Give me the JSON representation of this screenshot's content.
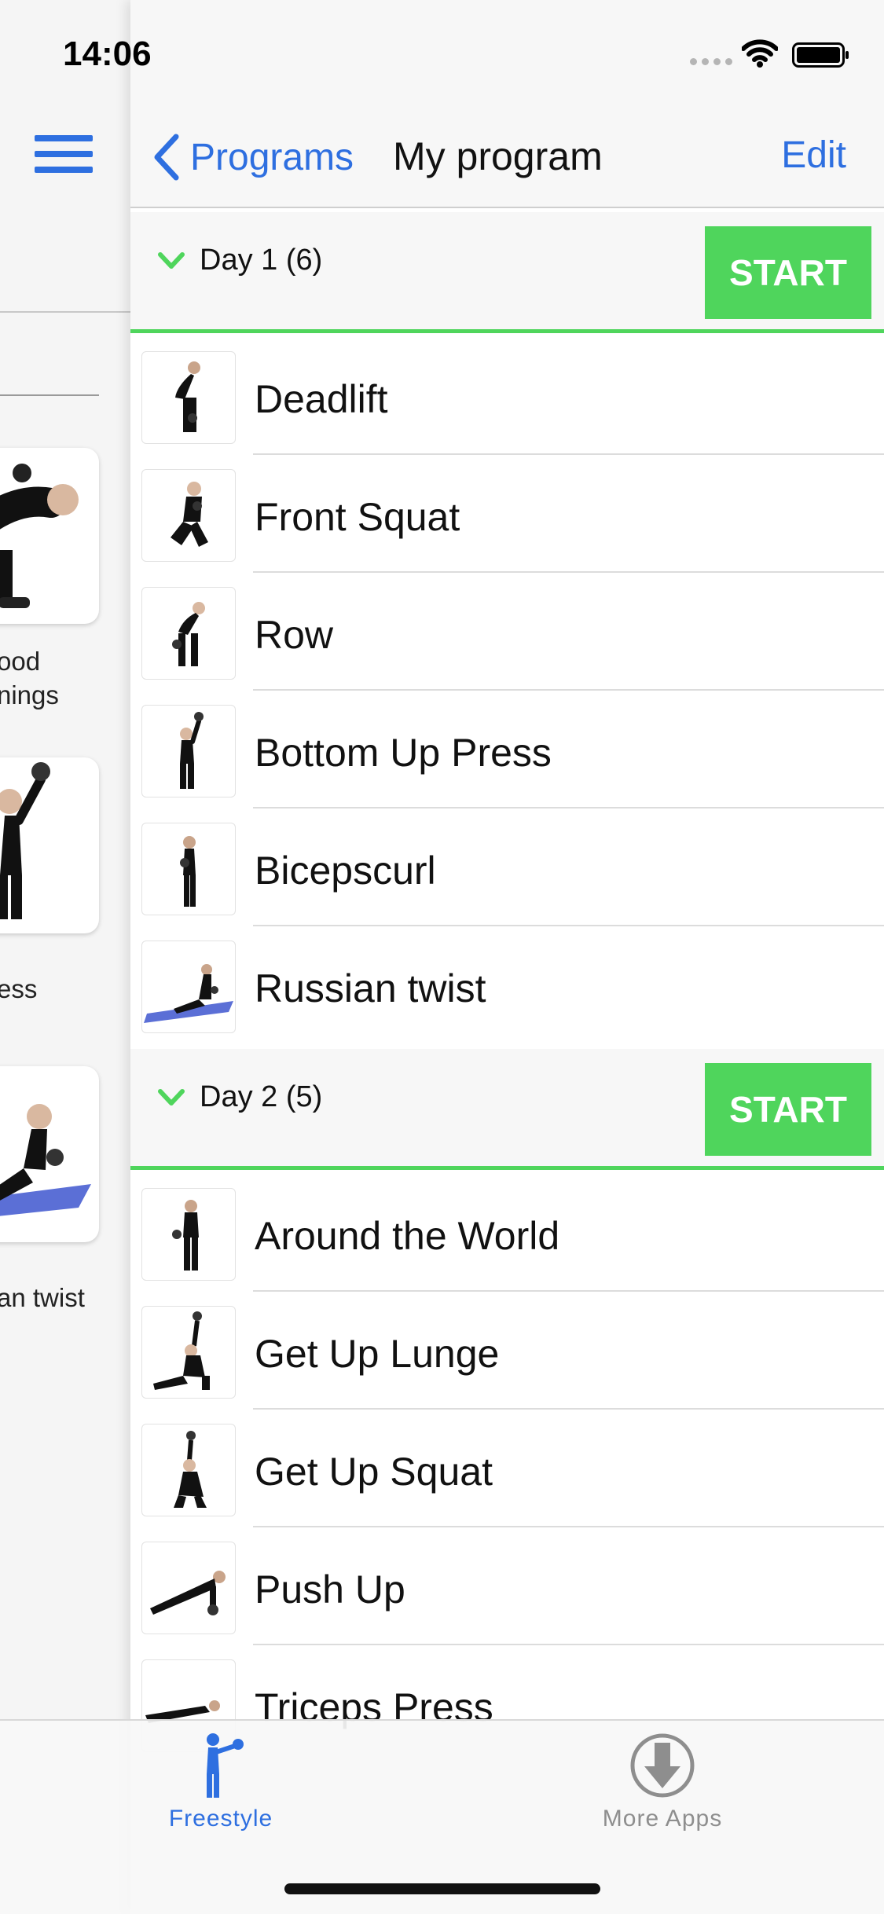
{
  "status_bar": {
    "time": "14:06"
  },
  "left_panel": {
    "captions": [
      "ood\nnings",
      "ess",
      "an twist"
    ]
  },
  "nav": {
    "back_label": "Programs",
    "title": "My program",
    "edit_label": "Edit"
  },
  "days": [
    {
      "label": "Day 1 (6)",
      "start_label": "START",
      "exercises": [
        "Deadlift",
        "Front Squat",
        "Row",
        "Bottom Up Press",
        "Bicepscurl",
        "Russian twist"
      ]
    },
    {
      "label": "Day 2 (5)",
      "start_label": "START",
      "exercises": [
        "Around the World",
        "Get Up Lunge",
        "Get Up Squat",
        "Push Up",
        "Triceps Press"
      ]
    }
  ],
  "tab_bar": {
    "tabs": [
      {
        "label": "Freestyle",
        "icon": "kettlebell-figure-icon",
        "active": true
      },
      {
        "label": "More Apps",
        "icon": "download-circle-icon",
        "active": false
      }
    ]
  },
  "colors": {
    "accent_blue": "#2e6fe0",
    "start_green": "#4fd55c",
    "inactive_gray": "#8e8e8e"
  }
}
